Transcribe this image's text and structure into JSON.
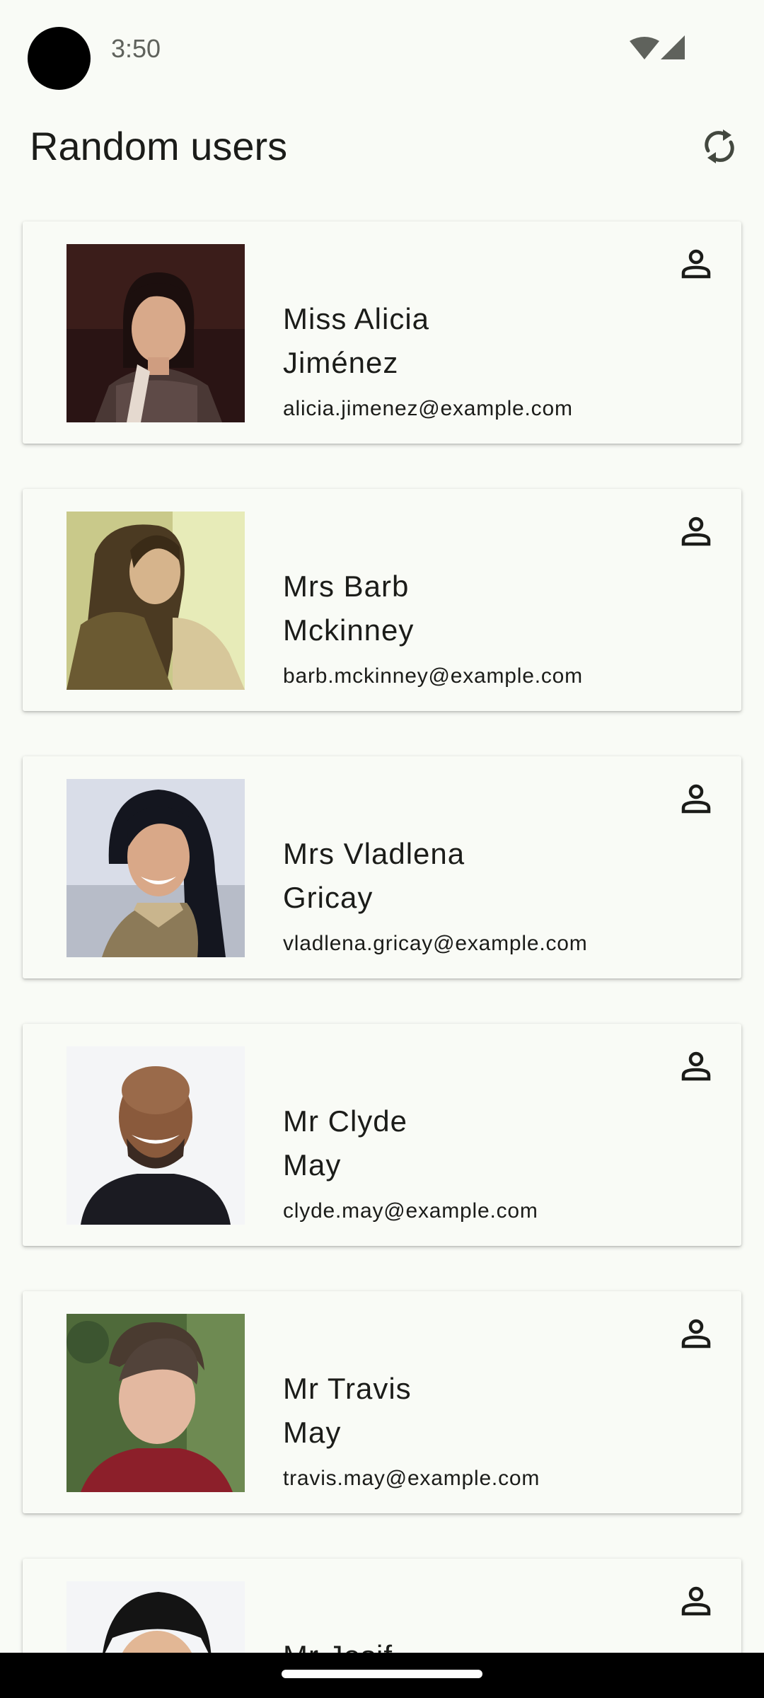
{
  "status_bar": {
    "time": "3:50"
  },
  "app_bar": {
    "title": "Random users"
  },
  "users": [
    {
      "first_line": "Miss Alicia",
      "second_line": "Jiménez",
      "email": "alicia.jimenez@example.com"
    },
    {
      "first_line": "Mrs Barb",
      "second_line": "Mckinney",
      "email": "barb.mckinney@example.com"
    },
    {
      "first_line": "Mrs Vladlena",
      "second_line": "Gricay",
      "email": "vladlena.gricay@example.com"
    },
    {
      "first_line": "Mr Clyde",
      "second_line": "May",
      "email": "clyde.may@example.com"
    },
    {
      "first_line": "Mr Travis",
      "second_line": "May",
      "email": "travis.may@example.com"
    },
    {
      "first_line": "Mr Josif",
      "second_line": "",
      "email": ""
    }
  ],
  "icons": {
    "refresh": "refresh-icon",
    "person": "person-outline-icon",
    "wifi": "wifi-icon",
    "signal": "cell-signal-icon"
  }
}
